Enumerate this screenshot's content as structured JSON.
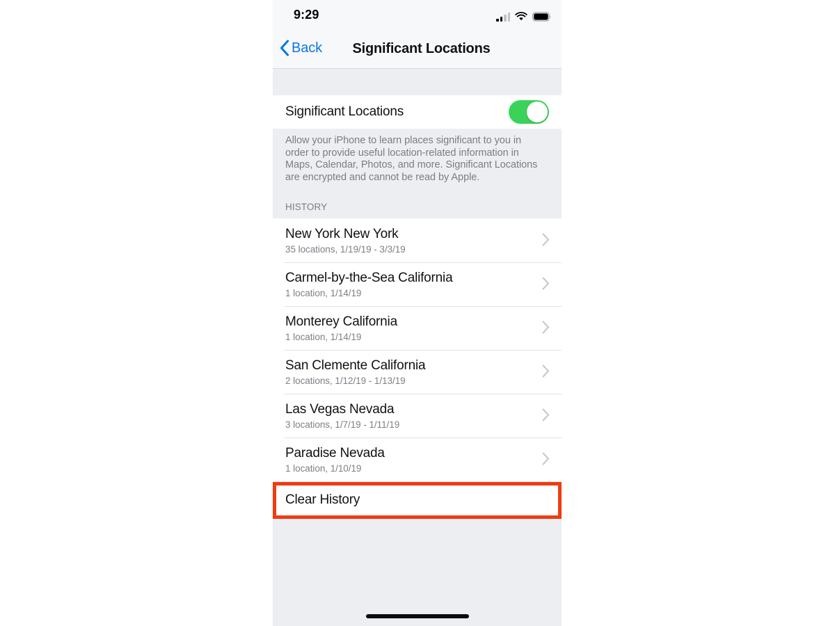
{
  "status_bar": {
    "time": "9:29",
    "signal_bars_filled": 2,
    "signal_bars_total": 4,
    "wifi_icon": "wifi-icon",
    "battery_icon": "battery-full-icon",
    "battery_level_pct": 100
  },
  "nav_bar": {
    "back_label": "Back",
    "back_icon": "chevron-left-icon",
    "title": "Significant Locations",
    "accent_color": "#0a76e8"
  },
  "master_toggle": {
    "label": "Significant Locations",
    "state": "on",
    "on_color": "#3ad35a"
  },
  "description": {
    "text": "Allow your iPhone to learn places significant to you in order to provide useful location-related information in Maps, Calendar, Photos, and more. Significant Locations are encrypted and cannot be read by Apple."
  },
  "history": {
    "section_header": "HISTORY",
    "disclosure_icon": "chevron-right-icon",
    "items": [
      {
        "title": "New York New York",
        "subtitle": "35 locations, 1/19/19 - 3/3/19"
      },
      {
        "title": "Carmel-by-the-Sea California",
        "subtitle": "1 location, 1/14/19"
      },
      {
        "title": "Monterey California",
        "subtitle": "1 location, 1/14/19"
      },
      {
        "title": "San Clemente California",
        "subtitle": "2 locations, 1/12/19 - 1/13/19"
      },
      {
        "title": "Las Vegas Nevada",
        "subtitle": "3 locations, 1/7/19 - 1/11/19"
      },
      {
        "title": "Paradise Nevada",
        "subtitle": "1 location, 1/10/19"
      }
    ]
  },
  "clear_history": {
    "label": "Clear History",
    "highlight_color": "#f03c10"
  },
  "home_indicator": {
    "present": true
  }
}
